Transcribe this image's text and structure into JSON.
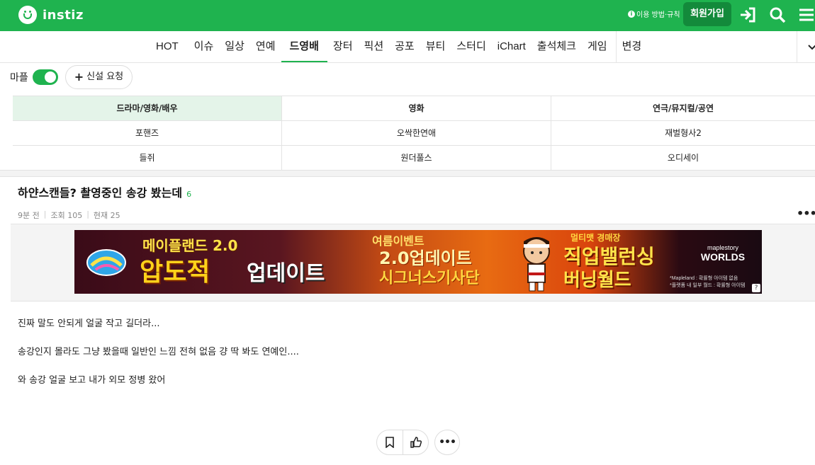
{
  "header": {
    "brand": "instiz",
    "rules_link": "이용 방법·규칙",
    "join_label": "회원가입",
    "icons": [
      "login-icon",
      "search-icon",
      "menu-icon"
    ]
  },
  "nav": {
    "tabs": [
      "HOT",
      "이슈",
      "일상",
      "연예",
      "드영배",
      "장터",
      "픽션",
      "공포",
      "뷰티",
      "스터디",
      "iChart",
      "출석체크",
      "게임",
      "변경"
    ],
    "active": "드영배"
  },
  "toolbar": {
    "map_label": "마플",
    "request_label": "신설 요청"
  },
  "board": {
    "headers": [
      "드라마/영화/배우",
      "영화",
      "연극/뮤지컬/공연"
    ],
    "rows": [
      [
        "포핸즈",
        "오싹한연애",
        "재벌형사2"
      ],
      [
        "들쥐",
        "원더풀스",
        "오디세이"
      ]
    ]
  },
  "post": {
    "title": "하얀스캔들? 촬영중인 송강 봤는데",
    "comment_count": "6",
    "time": "9분 전",
    "views": "조회 105",
    "now": "현재 25",
    "paragraphs": [
      "진짜 말도 안되게 얼굴 작고 길더라...",
      "송강인지 몰라도 그냥 봤을때 일반인 느낌 전혀 없음 걍 딱 봐도 연예인....",
      "와 송강 얼굴 보고 내가 외모 정병 왔어"
    ]
  },
  "banner": {
    "line1": "메이플랜드 2.0",
    "line2": "압도적",
    "line3": "업데이트",
    "event": "여름이벤트",
    "update": "2.0업데이트",
    "sub": "시그너스기사단",
    "party": "멀티맷 경매장",
    "balance": "직업밸런싱",
    "world": "버닝월드",
    "worlds_small": "maplestory",
    "worlds": "WORLDS",
    "fine1": "*Mapleland : 확률형 아이템 없음",
    "fine2": "*플랫폼 내 일부 월드 : 확률형 아이템",
    "help": "?"
  }
}
